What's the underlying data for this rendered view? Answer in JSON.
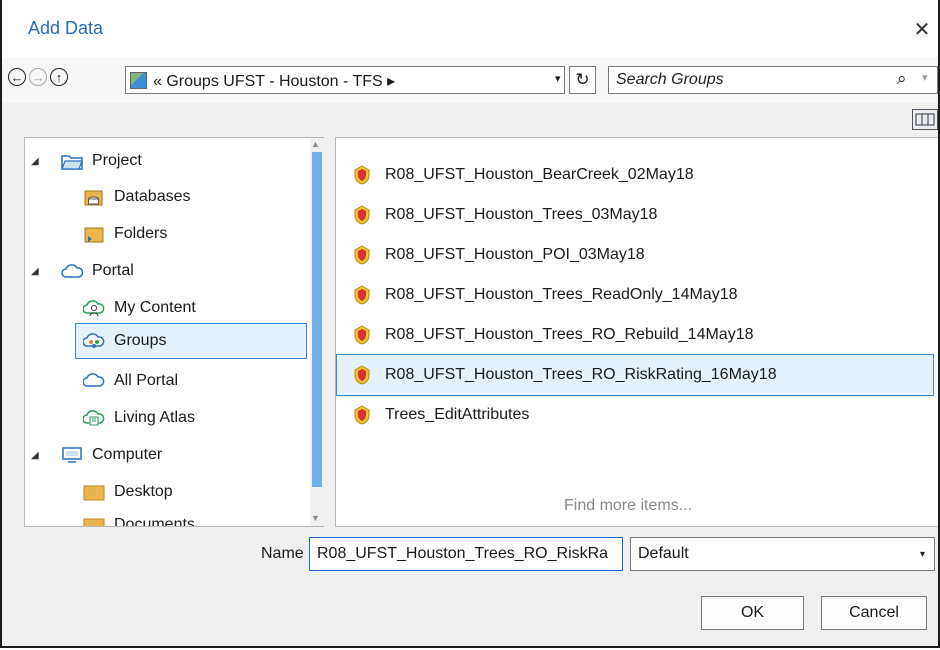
{
  "dialog": {
    "title": "Add Data",
    "close_glyph": "✕"
  },
  "nav": {
    "back_glyph": "←",
    "forward_glyph": "→",
    "up_glyph": "↑",
    "address": "« Groups  UFST - Houston - TFS ▸",
    "address_dropdown": "▾",
    "refresh_glyph": "↻",
    "search_placeholder": "Search Groups",
    "search_icon": "search-icon",
    "search_glyph": "⌕",
    "search_dropdown": "▾"
  },
  "tree": {
    "project": "Project",
    "databases": "Databases",
    "folders": "Folders",
    "portal": "Portal",
    "my_content": "My Content",
    "groups": "Groups",
    "all_portal": "All Portal",
    "living_atlas": "Living Atlas",
    "computer": "Computer",
    "desktop": "Desktop",
    "documents_partial": "Documents",
    "expand_glyph": "◢"
  },
  "items": [
    "R08_UFST_Houston_BearCreek_02May18",
    "R08_UFST_Houston_Trees_03May18",
    "R08_UFST_Houston_POI_03May18",
    "R08_UFST_Houston_Trees_ReadOnly_14May18",
    "R08_UFST_Houston_Trees_RO_Rebuild_14May18",
    "R08_UFST_Houston_Trees_RO_RiskRating_16May18",
    "Trees_EditAttributes"
  ],
  "find_more": "Find more items...",
  "footer": {
    "name_label": "Name",
    "name_value": "R08_UFST_Houston_Trees_RO_RiskRa",
    "type_value": "Default",
    "type_dropdown": "▾",
    "ok": "OK",
    "cancel": "Cancel"
  },
  "colors": {
    "accent": "#2a6bb5",
    "selection_bg": "#e5f1fb",
    "selection_border": "#3a89d0",
    "scroll_thumb": "#6fb0e9"
  }
}
